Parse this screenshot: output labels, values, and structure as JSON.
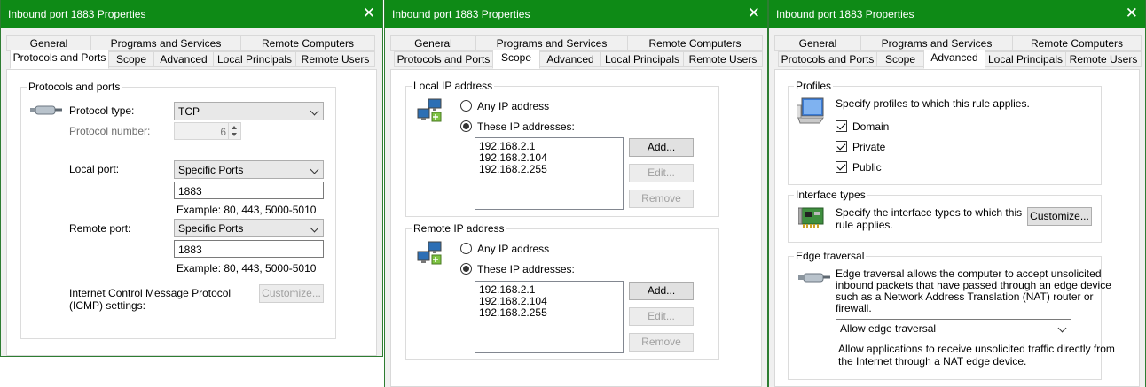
{
  "windows": [
    {
      "title": "Inbound port 1883 Properties",
      "tabs_row1": [
        "General",
        "Programs and Services",
        "Remote Computers"
      ],
      "tabs_row2": [
        "Protocols and Ports",
        "Scope",
        "Advanced",
        "Local Principals",
        "Remote Users"
      ],
      "selected_tab": "Protocols and Ports",
      "group_title": "Protocols and ports",
      "protocol_type_label": "Protocol type:",
      "protocol_type_value": "TCP",
      "protocol_number_label": "Protocol number:",
      "protocol_number_value": "6",
      "local_port_label": "Local port:",
      "local_port_mode": "Specific Ports",
      "local_port_value": "1883",
      "example_text": "Example: 80, 443, 5000-5010",
      "remote_port_label": "Remote port:",
      "remote_port_mode": "Specific Ports",
      "remote_port_value": "1883",
      "icmp_label_line1": "Internet Control Message Protocol",
      "icmp_label_line2": "(ICMP) settings:",
      "customize_label": "Customize..."
    },
    {
      "title": "Inbound port 1883 Properties",
      "tabs_row1": [
        "General",
        "Programs and Services",
        "Remote Computers"
      ],
      "tabs_row2": [
        "Protocols and Ports",
        "Scope",
        "Advanced",
        "Local Principals",
        "Remote Users"
      ],
      "selected_tab": "Scope",
      "local_group_title": "Local IP address",
      "remote_group_title": "Remote IP address",
      "any_ip_label": "Any IP address",
      "these_ip_label": "These IP addresses:",
      "local_ips": [
        "192.168.2.1",
        "192.168.2.104",
        "192.168.2.255"
      ],
      "remote_ips": [
        "192.168.2.1",
        "192.168.2.104",
        "192.168.2.255"
      ],
      "add_label": "Add...",
      "edit_label": "Edit...",
      "remove_label": "Remove"
    },
    {
      "title": "Inbound port 1883 Properties",
      "tabs_row1": [
        "General",
        "Programs and Services",
        "Remote Computers"
      ],
      "tabs_row2": [
        "Protocols and Ports",
        "Scope",
        "Advanced",
        "Local Principals",
        "Remote Users"
      ],
      "selected_tab": "Advanced",
      "profiles_title": "Profiles",
      "profiles_desc": "Specify profiles to which this rule applies.",
      "profiles": [
        {
          "label": "Domain",
          "checked": true
        },
        {
          "label": "Private",
          "checked": true
        },
        {
          "label": "Public",
          "checked": true
        }
      ],
      "interface_title": "Interface types",
      "interface_desc_line1": "Specify the interface types to which this",
      "interface_desc_line2": "rule applies.",
      "customize_label": "Customize...",
      "edge_title": "Edge traversal",
      "edge_desc_line1": "Edge traversal allows the computer to accept unsolicited",
      "edge_desc_line2": "inbound packets that have passed through an edge device",
      "edge_desc_line3": "such as a Network Address Translation (NAT) router or",
      "edge_desc_line4": "firewall.",
      "edge_value": "Allow edge traversal",
      "edge_help_line1": "Allow applications to receive unsolicited traffic directly from",
      "edge_help_line2": "the Internet through a NAT edge device."
    }
  ]
}
